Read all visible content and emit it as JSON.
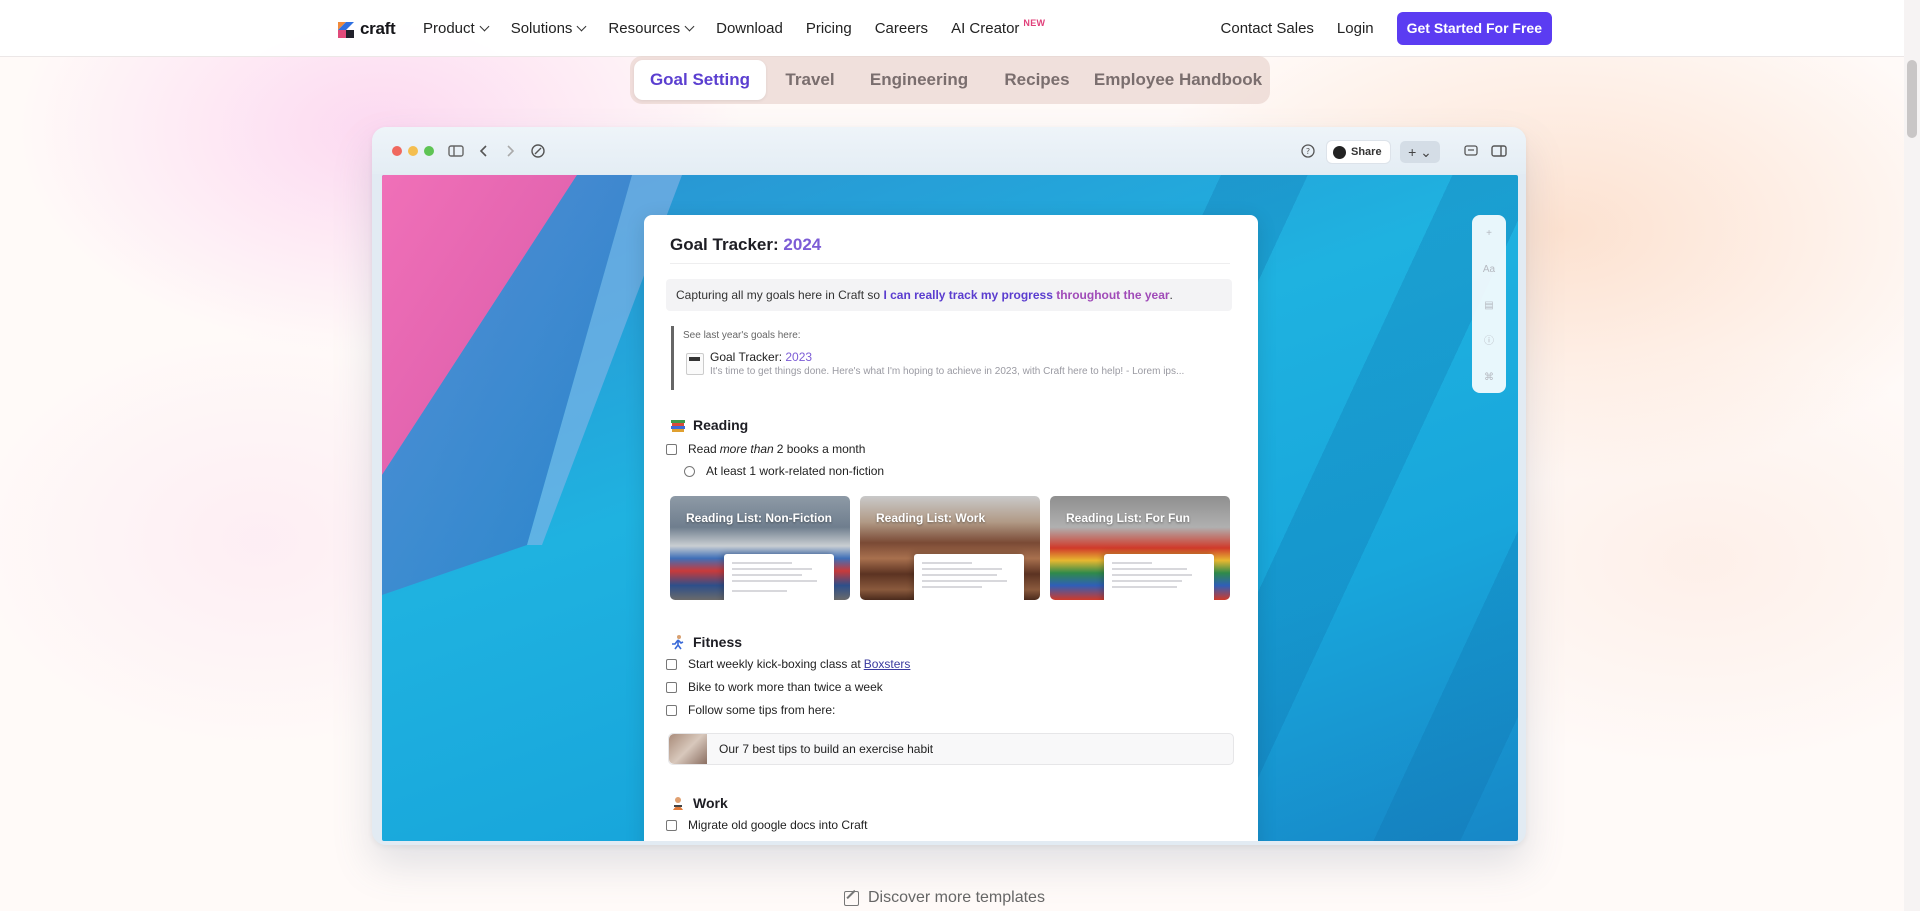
{
  "nav": {
    "logo_text": "craft",
    "links": [
      {
        "label": "Product",
        "has_menu": true
      },
      {
        "label": "Solutions",
        "has_menu": true
      },
      {
        "label": "Resources",
        "has_menu": true
      },
      {
        "label": "Download",
        "has_menu": false
      },
      {
        "label": "Pricing",
        "has_menu": false
      },
      {
        "label": "Careers",
        "has_menu": false
      },
      {
        "label": "AI Creator",
        "has_menu": false
      }
    ],
    "ai_badge": "NEW",
    "contact_sales": "Contact Sales",
    "login": "Login",
    "cta": "Get Started For Free"
  },
  "tabs": [
    "Goal Setting",
    "Travel",
    "Engineering",
    "Recipes",
    "Employee Handbook"
  ],
  "active_tab": "Goal Setting",
  "window": {
    "share_label": "Share",
    "plus_label": "+ ⌄"
  },
  "side_tools": [
    "+",
    "Aa",
    "▤",
    "ⓘ",
    "⌘"
  ],
  "doc": {
    "title_prefix": "Goal Tracker:",
    "title_year": "2024",
    "callout_plain": "Capturing all my goals here in Craft so ",
    "callout_bold_1": "I can really track my progress ",
    "callout_bold_2": "throughout the year",
    "callout_end": ".",
    "quote_label": "See last year's goals here:",
    "linked_title_prefix": "Goal Tracker:",
    "linked_title_year": "2023",
    "linked_subtitle": "It's time to get things done. Here's what I'm hoping to achieve in 2023, with Craft here to help! - Lorem ips...",
    "reading": {
      "heading": "Reading",
      "todo_1_pre": "Read ",
      "todo_1_em": "more than",
      "todo_1_post": " 2 books a month",
      "subtodo": "At least 1 work-related non-fiction",
      "cards": [
        "Reading List: Non-Fiction",
        "Reading List: Work",
        "Reading List: For Fun"
      ]
    },
    "fitness": {
      "heading": "Fitness",
      "todo_1_pre": "Start weekly kick-boxing class at ",
      "todo_1_link": "Boxsters",
      "todo_2": "Bike to work more than twice a week",
      "todo_3": "Follow some tips from here:",
      "link_card": "Our 7 best tips to build an exercise habit"
    },
    "work": {
      "heading": "Work",
      "todo_1": "Migrate old google docs into Craft"
    }
  },
  "discover": "Discover more templates",
  "colors": {
    "accent": "#5b3cf2",
    "tab_active": "#5b3fd0",
    "year": "#7c5cd6"
  }
}
